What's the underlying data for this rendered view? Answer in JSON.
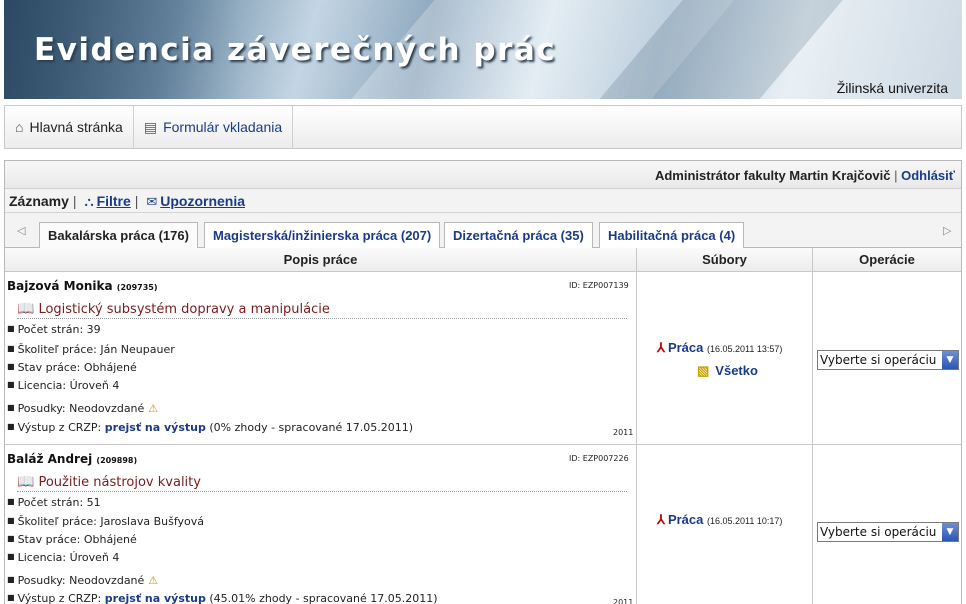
{
  "banner": {
    "title": "Evidencia záverečných prác",
    "university": "Žilinská univerzita"
  },
  "menu": {
    "home": "Hlavná stránka",
    "form": "Formulár vkladania"
  },
  "admin": {
    "user": "Administrátor fakulty Martin Krajčovič",
    "separator": "|",
    "logout": "Odhlásiť"
  },
  "records": {
    "label": "Záznamy",
    "separator": "|",
    "filters": "Filtre",
    "alerts": "Upozornenia"
  },
  "tabs": [
    {
      "label": "Bakalárska práca (176)",
      "active": true
    },
    {
      "label": "Magisterská/inžinierska práca (207)",
      "active": false
    },
    {
      "label": "Dizertačná práca (35)",
      "active": false
    },
    {
      "label": "Habilitačná práca (4)",
      "active": false
    }
  ],
  "columns": {
    "description": "Popis práce",
    "files": "Súbory",
    "operations": "Operácie"
  },
  "rows": [
    {
      "author": "Bajzová Monika",
      "author_id": "(209735)",
      "id": "ID: EZP007139",
      "title": "Logistický subsystém dopravy a manipulácie",
      "pages": "Počet strán: 39",
      "supervisor": "Školiteľ práce: Ján Neupauer",
      "state": "Stav práce: Obhájené",
      "license": "Licencia: Úroveň 4",
      "reviews": "Posudky: Neodovzdané",
      "crzp_label": "Výstup z CRZP: ",
      "crzp_link": "prejsť na výstup",
      "crzp_note": " (0% zhody - spracované 17.05.2011)",
      "year": "2011",
      "file_label": "Práca",
      "file_date": "(16.05.2011 13:57)",
      "all_files": "Všetko",
      "operation": "Vyberte si operáciu"
    },
    {
      "author": "Baláž Andrej",
      "author_id": "(209898)",
      "id": "ID: EZP007226",
      "title": "Použitie nástrojov kvality",
      "pages": "Počet strán: 51",
      "supervisor": "Školiteľ práce: Jaroslava Bušfyová",
      "state": "Stav práce: Obhájené",
      "license": "Licencia: Úroveň 4",
      "reviews": "Posudky: Neodovzdané",
      "crzp_label": "Výstup z CRZP: ",
      "crzp_link": "prejsť na výstup",
      "crzp_note": " (45.01% zhody - spracované 17.05.2011)",
      "year": "2011",
      "file_label": "Práca",
      "file_date": "(16.05.2011 10:17)",
      "operation": "Vyberte si operáciu"
    }
  ]
}
